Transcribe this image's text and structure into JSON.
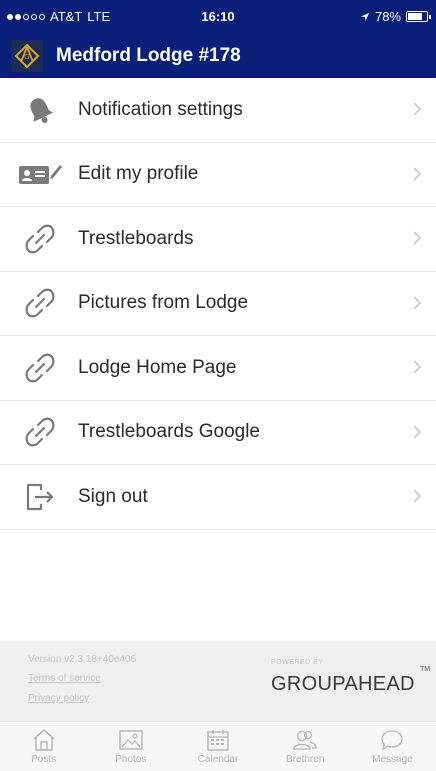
{
  "status_bar": {
    "carrier": "AT&T",
    "network": "LTE",
    "time": "16:10",
    "battery": "78%",
    "battery_level": 0.78
  },
  "header": {
    "title": "Medford Lodge #178"
  },
  "menu": {
    "items": [
      {
        "label": "Notification settings",
        "icon": "bell-icon"
      },
      {
        "label": "Edit my profile",
        "icon": "id-card-edit-icon"
      },
      {
        "label": "Trestleboards",
        "icon": "link-icon"
      },
      {
        "label": "Pictures from Lodge",
        "icon": "link-icon"
      },
      {
        "label": "Lodge Home Page",
        "icon": "link-icon"
      },
      {
        "label": "Trestleboards Google",
        "icon": "link-icon"
      },
      {
        "label": "Sign out",
        "icon": "sign-out-icon"
      }
    ]
  },
  "footer": {
    "version": "Version v2.3.18+40e406",
    "terms": "Terms of service",
    "privacy": "Privacy policy",
    "powered_by": "POWERED BY",
    "brand": "GROUPAHEAD",
    "trademark": "TM"
  },
  "tabbar": {
    "tabs": [
      {
        "label": "Posts",
        "icon": "home-icon"
      },
      {
        "label": "Photos",
        "icon": "photo-icon"
      },
      {
        "label": "Calendar",
        "icon": "calendar-icon"
      },
      {
        "label": "Brethren",
        "icon": "people-icon"
      },
      {
        "label": "Message",
        "icon": "chat-bubble-icon"
      }
    ]
  },
  "colors": {
    "brand_navy": "#0a1f7a",
    "icon_gray": "#7a7a7a",
    "footer_bg": "#efefef"
  }
}
